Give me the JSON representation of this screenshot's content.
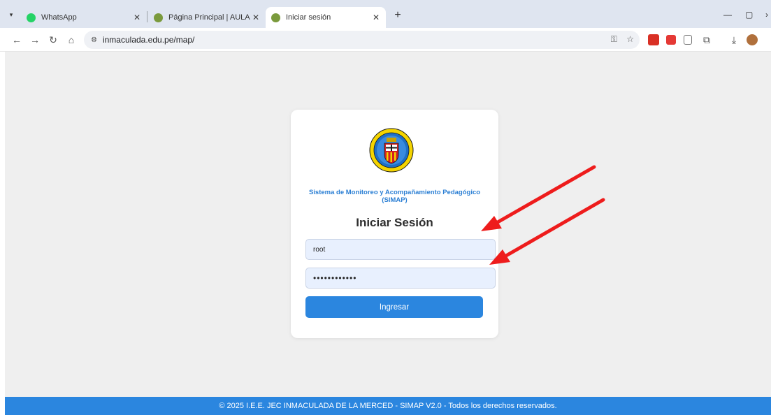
{
  "browser": {
    "tabs": [
      {
        "title": "WhatsApp",
        "favicon_color": "#25d366"
      },
      {
        "title": "Página Principal | AULA VIRTUAL",
        "favicon_color": "#7a9a3c"
      },
      {
        "title": "Iniciar sesión",
        "favicon_color": "#7a9a3c"
      }
    ],
    "active_tab_index": 2,
    "url": "inmaculada.edu.pe/map/"
  },
  "login": {
    "system_title": "Sistema de Monitoreo y Acompañamiento Pedagógico (SIMAP)",
    "heading": "Iniciar Sesión",
    "username_value": "root",
    "password_value": "••••••••••••",
    "submit_label": "Ingresar"
  },
  "footer": {
    "text": "© 2025 I.E.E. JEC INMACULADA DE LA MERCED - SIMAP V2.0 - Todos los derechos reservados."
  },
  "colors": {
    "accent": "#2b86df",
    "annotation_arrow": "#ee1c1c",
    "field_bg": "#e8f0fe"
  }
}
